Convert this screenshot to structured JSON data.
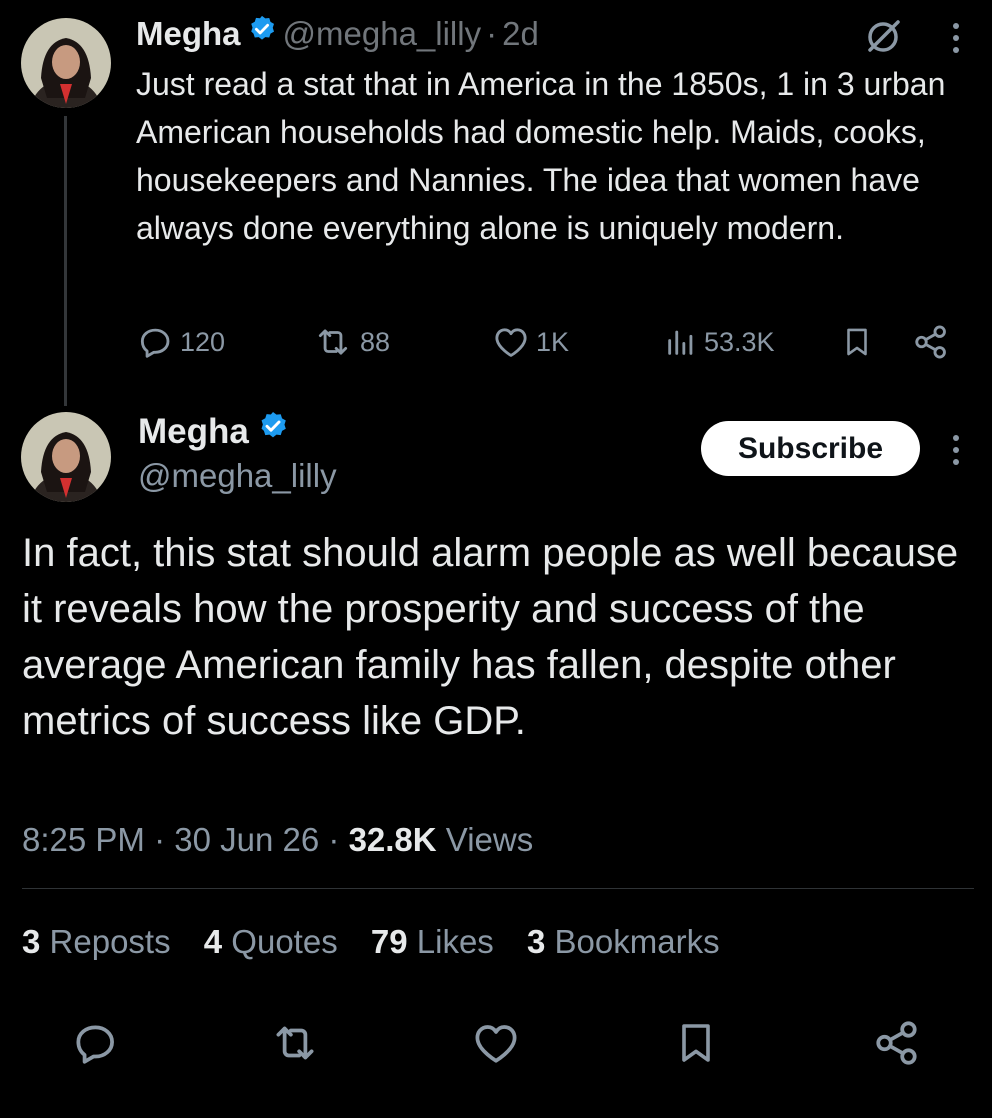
{
  "parent": {
    "name": "Megha",
    "handle": "@megha_lilly",
    "separator": "·",
    "time": "2d",
    "text": "Just read a stat that in America in the 1850s, 1 in 3 urban American households had domestic help. Maids, cooks, housekeepers and Nannies. The idea that women have always done everything alone is uniquely modern.",
    "actions": {
      "replies": "120",
      "reposts": "88",
      "likes": "1K",
      "views": "53.3K"
    }
  },
  "main": {
    "name": "Megha",
    "handle": "@megha_lilly",
    "subscribe_label": "Subscribe",
    "text": "In fact, this stat should alarm people as well because it reveals how the prosperity and success of the average American family has fallen, despite other metrics of success like GDP.",
    "meta": {
      "time": "8:25 PM",
      "date": "30 Jun 26",
      "separator": "·",
      "views_count": "32.8K",
      "views_label": "Views"
    },
    "stats": {
      "reposts_count": "3",
      "reposts_label": "Reposts",
      "quotes_count": "4",
      "quotes_label": "Quotes",
      "likes_count": "79",
      "likes_label": "Likes",
      "bookmarks_count": "3",
      "bookmarks_label": "Bookmarks"
    }
  },
  "colors": {
    "background": "#000000",
    "text_primary": "#e7e9ea",
    "text_muted": "#8b98a5",
    "verified_blue": "#1d9bf0",
    "divider": "#2f3336"
  },
  "icons": [
    "grok-icon",
    "more-icon",
    "reply-icon",
    "repost-icon",
    "like-icon",
    "views-icon",
    "bookmark-icon",
    "share-icon",
    "verified-icon"
  ]
}
